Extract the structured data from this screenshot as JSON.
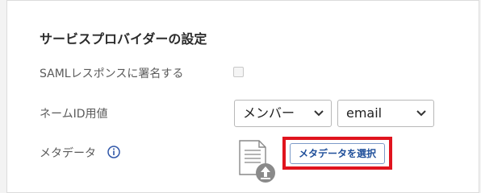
{
  "section": {
    "title": "サービスプロバイダーの設定"
  },
  "fields": {
    "saml_sign": {
      "label": "SAMLレスポンスに署名する",
      "checked": false
    },
    "nameid": {
      "label": "ネームID用値",
      "select1_value": "メンバー",
      "select2_value": "email"
    },
    "metadata": {
      "label": "メタデータ",
      "info_icon": "info-icon",
      "file_icon": "document-upload-icon",
      "button_label": "メタデータを選択"
    }
  },
  "colors": {
    "highlight": "#e0141e",
    "button_text": "#1f4f9a",
    "info_icon": "#2f56a8"
  }
}
